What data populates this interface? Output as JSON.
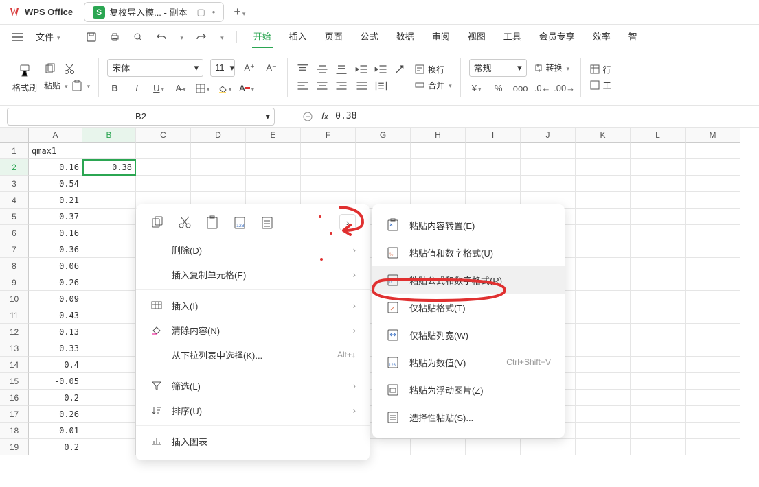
{
  "app_title": "WPS Office",
  "tab": {
    "title": "复校导入模... - 副本",
    "icon_letter": "S"
  },
  "menu": {
    "file": "文件",
    "tabs": [
      "开始",
      "插入",
      "页面",
      "公式",
      "数据",
      "审阅",
      "视图",
      "工具",
      "会员专享",
      "效率",
      "智"
    ],
    "active_tab": "开始"
  },
  "ribbon": {
    "format_brush": "格式刷",
    "paste": "粘贴",
    "font_name": "宋体",
    "font_size": "11",
    "wrap_text": "换行",
    "merge": "合并",
    "number_format": "常规",
    "convert": "转换",
    "rows_cols": "行"
  },
  "name_box": "B2",
  "formula_label": "fx",
  "formula_value": "0.38",
  "columns": [
    "A",
    "B",
    "C",
    "D",
    "E",
    "F",
    "G",
    "H",
    "I",
    "J",
    "K",
    "L",
    "M"
  ],
  "active_col": "B",
  "active_row": 2,
  "rows": [
    {
      "n": 1,
      "a": "qmax1",
      "b": ""
    },
    {
      "n": 2,
      "a": "0.16",
      "b": "0.38"
    },
    {
      "n": 3,
      "a": "0.54",
      "b": ""
    },
    {
      "n": 4,
      "a": "0.21",
      "b": ""
    },
    {
      "n": 5,
      "a": "0.37",
      "b": ""
    },
    {
      "n": 6,
      "a": "0.16",
      "b": ""
    },
    {
      "n": 7,
      "a": "0.36",
      "b": ""
    },
    {
      "n": 8,
      "a": "0.06",
      "b": ""
    },
    {
      "n": 9,
      "a": "0.26",
      "b": ""
    },
    {
      "n": 10,
      "a": "0.09",
      "b": ""
    },
    {
      "n": 11,
      "a": "0.43",
      "b": ""
    },
    {
      "n": 12,
      "a": "0.13",
      "b": ""
    },
    {
      "n": 13,
      "a": "0.33",
      "b": ""
    },
    {
      "n": 14,
      "a": "0.4",
      "b": ""
    },
    {
      "n": 15,
      "a": "-0.05",
      "b": ""
    },
    {
      "n": 16,
      "a": "0.2",
      "b": ""
    },
    {
      "n": 17,
      "a": "0.26",
      "b": ""
    },
    {
      "n": 18,
      "a": "-0.01",
      "b": ""
    },
    {
      "n": 19,
      "a": "0.2",
      "b": ""
    }
  ],
  "context_menu": {
    "delete": "删除(D)",
    "insert_copied": "插入复制单元格(E)",
    "insert": "插入(I)",
    "clear": "清除内容(N)",
    "dropdown_list": "从下拉列表中选择(K)...",
    "dropdown_shortcut": "Alt+↓",
    "filter": "筛选(L)",
    "sort": "排序(U)",
    "insert_chart": "插入图表"
  },
  "submenu": {
    "paste_transpose": "粘贴内容转置(E)",
    "paste_values_format": "粘贴值和数字格式(U)",
    "paste_formula_format": "粘贴公式和数字格式(R)",
    "paste_format_only": "仅粘贴格式(T)",
    "paste_col_width": "仅粘贴列宽(W)",
    "paste_as_values": "粘贴为数值(V)",
    "paste_as_values_shortcut": "Ctrl+Shift+V",
    "paste_as_picture": "粘贴为浮动图片(Z)",
    "paste_special": "选择性粘贴(S)..."
  }
}
